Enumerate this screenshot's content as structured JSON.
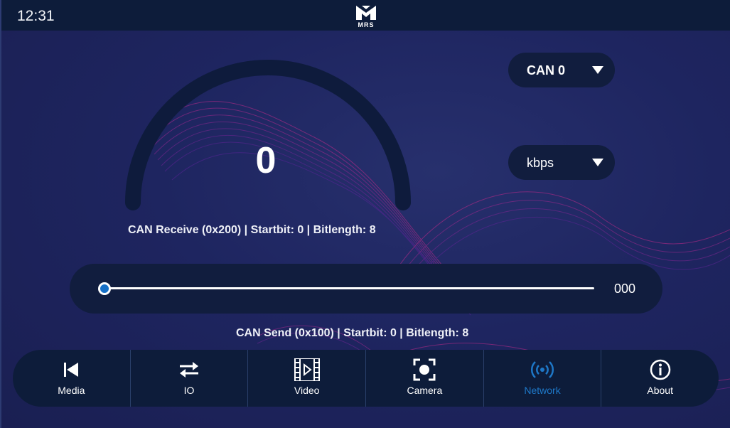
{
  "topbar": {
    "time": "12:31",
    "logo_text": "MRS"
  },
  "gauge": {
    "value": "0",
    "fill_fraction": 0
  },
  "receive_label": "CAN Receive (0x200) | Startbit: 0 | Bitlength: 8",
  "dropdowns": {
    "can": {
      "selected": "CAN 0",
      "icon": "chevron-down-icon"
    },
    "unit": {
      "selected": "kbps",
      "icon": "chevron-down-icon"
    }
  },
  "slider": {
    "value": "000",
    "fraction": 0
  },
  "send_label": "CAN Send (0x100) | Startbit: 0 | Bitlength: 8",
  "nav": [
    {
      "label": "Media",
      "icon": "skip-back-icon"
    },
    {
      "label": "IO",
      "icon": "swap-arrows-icon"
    },
    {
      "label": "Video",
      "icon": "film-play-icon"
    },
    {
      "label": "Camera",
      "icon": "camera-focus-icon"
    },
    {
      "label": "Network",
      "icon": "broadcast-icon",
      "active": true
    },
    {
      "label": "About",
      "icon": "info-icon"
    }
  ],
  "colors": {
    "background": "#1e2560",
    "bar": "#0d1c3a",
    "card": "#111d3e",
    "accent": "#1e78c8",
    "wave": "#c02a8a"
  }
}
